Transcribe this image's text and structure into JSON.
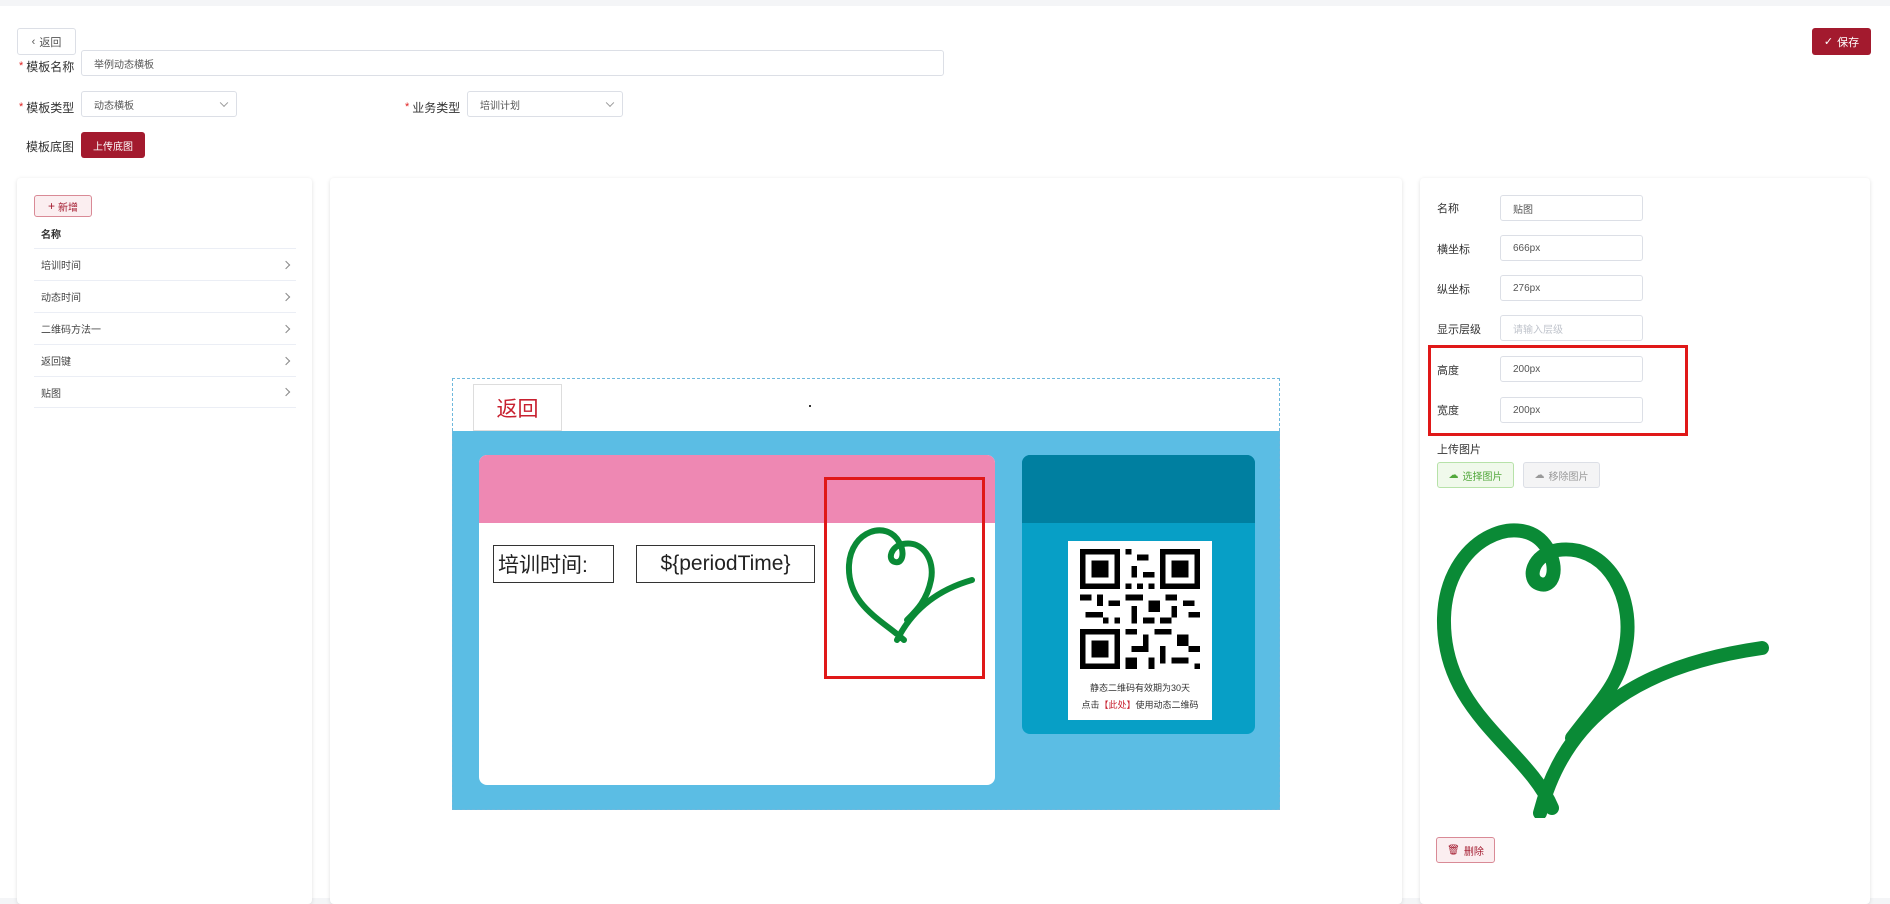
{
  "header": {
    "back_label": "返回",
    "save_label": "保存"
  },
  "form": {
    "template_name_label": "模板名称",
    "template_name_value": "举例动态横板",
    "template_type_label": "模板类型",
    "template_type_value": "动态横板",
    "business_type_label": "业务类型",
    "business_type_value": "培训计划",
    "background_label": "模板底图",
    "upload_background_label": "上传底图"
  },
  "left_panel": {
    "add_label": "新增",
    "list_header": "名称",
    "items": [
      {
        "label": "培训时间"
      },
      {
        "label": "动态时间"
      },
      {
        "label": "二维码方法一"
      },
      {
        "label": "返回键"
      },
      {
        "label": "贴图"
      }
    ]
  },
  "canvas": {
    "back_text": "返回",
    "label_text": "培训时间:",
    "value_text": "${periodTime}",
    "qr_line1": "静态二维码有效期为30天",
    "qr_line2_prefix": "点击",
    "qr_line2_link": "【此处】",
    "qr_line2_suffix": "使用动态二维码",
    "colors": {
      "canvas_bg": "#5bbde4",
      "pink_header": "#ee88b3",
      "teal_card": "#079fc6",
      "teal_header": "#007fa0",
      "heart": "#0a8a36",
      "highlight": "#e01818"
    }
  },
  "right_panel": {
    "name_label": "名称",
    "name_value": "贴图",
    "x_label": "横坐标",
    "x_value": "666px",
    "y_label": "纵坐标",
    "y_value": "276px",
    "z_label": "显示层级",
    "z_placeholder": "请输入层级",
    "height_label": "高度",
    "height_value": "200px",
    "width_label": "宽度",
    "width_value": "200px",
    "upload_label": "上传图片",
    "choose_label": "选择图片",
    "remove_label": "移除图片",
    "delete_label": "删除"
  },
  "theme": {
    "primary": "#a31a2e"
  }
}
